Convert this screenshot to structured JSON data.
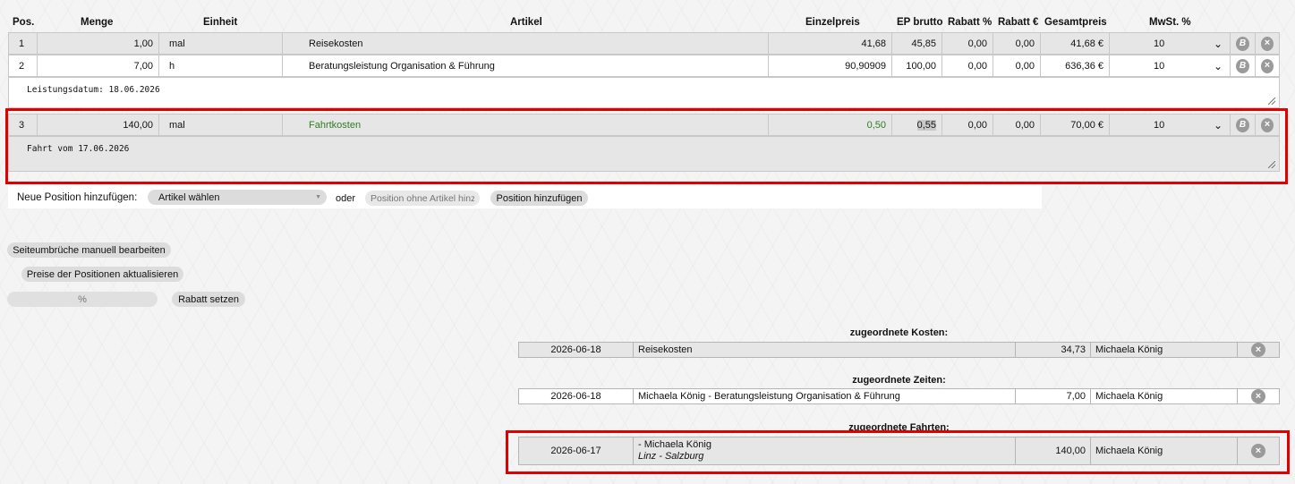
{
  "headers": {
    "pos": "Pos.",
    "menge": "Menge",
    "einheit": "Einheit",
    "artikel": "Artikel",
    "einzelpreis": "Einzelpreis",
    "ep_brutto": "EP brutto",
    "rabatt_pct": "Rabatt %",
    "rabatt_eur": "Rabatt €",
    "gesamtpreis": "Gesamtpreis",
    "mwst": "MwSt. %"
  },
  "rows": [
    {
      "pos": "1",
      "menge": "1,00",
      "einheit": "mal",
      "artikel": "Reisekosten",
      "einzelpreis": "41,68",
      "ep_brutto": "45,85",
      "rabatt_pct": "0,00",
      "rabatt_eur": "0,00",
      "gesamtpreis": "41,68 €",
      "mwst": "10"
    },
    {
      "pos": "2",
      "menge": "7,00",
      "einheit": "h",
      "artikel": "Beratungsleistung Organisation & Führung",
      "einzelpreis": "90,90909",
      "ep_brutto": "100,00",
      "rabatt_pct": "0,00",
      "rabatt_eur": "0,00",
      "gesamtpreis": "636,36 €",
      "mwst": "10",
      "note": "Leistungsdatum: 18.06.2026"
    },
    {
      "pos": "3",
      "menge": "140,00",
      "einheit": "mal",
      "artikel": "Fahrtkosten",
      "einzelpreis": "0,50",
      "ep_brutto": "0,55",
      "rabatt_pct": "0,00",
      "rabatt_eur": "0,00",
      "gesamtpreis": "70,00 €",
      "mwst": "10",
      "note": "Fahrt vom 17.06.2026"
    }
  ],
  "row_icons": {
    "b_label": "B",
    "x_label": "×",
    "chevron": "⌄"
  },
  "add_position": {
    "label": "Neue Position hinzufügen:",
    "select_value": "Artikel wählen",
    "oder": "oder",
    "input_placeholder": "Position ohne Artikel hinz",
    "button": "Position hinzufügen"
  },
  "actions": {
    "page_breaks": "Seiteumbrüche manuell bearbeiten",
    "update_prices": "Preise der Positionen aktualisieren",
    "discount_placeholder": "%",
    "set_discount": "Rabatt setzen"
  },
  "assigned": {
    "costs": {
      "title": "zugeordnete Kosten:",
      "date": "2026-06-18",
      "desc": "Reisekosten",
      "amount": "34,73",
      "person": "Michaela König"
    },
    "times": {
      "title": "zugeordnete Zeiten:",
      "date": "2026-06-18",
      "desc": "Michaela König - Beratungsleistung Organisation & Führung",
      "amount": "7,00",
      "person": "Michaela König"
    },
    "trips": {
      "title": "zugeordnete Fahrten:",
      "date": "2026-06-17",
      "desc": "- Michaela König",
      "route": "Linz - Salzburg",
      "amount": "140,00",
      "person": "Michaela König"
    }
  },
  "colors": {
    "highlight": "#e00000",
    "row_grey": "#e6e6e6",
    "green_text": "#2e7d1e"
  }
}
